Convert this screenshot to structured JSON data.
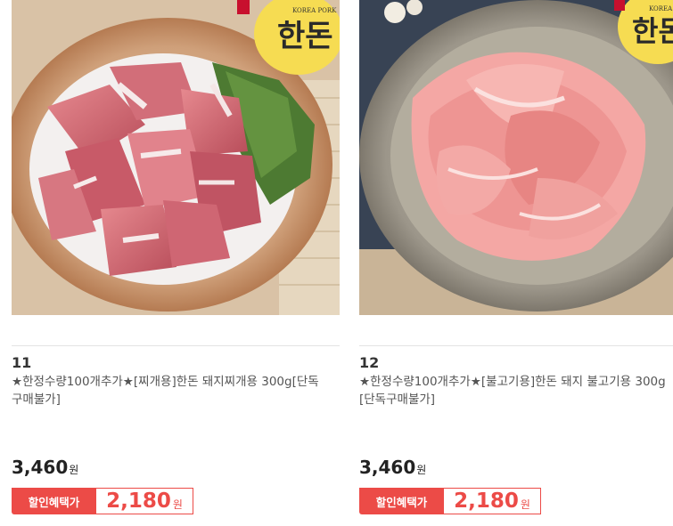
{
  "products": [
    {
      "rank": "11",
      "title": "★한정수량100개추가★[찌개용]한돈 돼지찌개용 300g[단독구매불가]",
      "price": "3,460",
      "price_unit": "원",
      "discount_label": "할인혜택가",
      "discount_price": "2,180",
      "discount_unit": "원",
      "logo_text": "KOREA PORK"
    },
    {
      "rank": "12",
      "title": "★한정수량100개추가★[불고기용]한돈 돼지 불고기용 300g[단독구매불가]",
      "price": "3,460",
      "price_unit": "원",
      "discount_label": "할인혜택가",
      "discount_price": "2,180",
      "discount_unit": "원",
      "logo_text": "KOREA PORK"
    }
  ]
}
